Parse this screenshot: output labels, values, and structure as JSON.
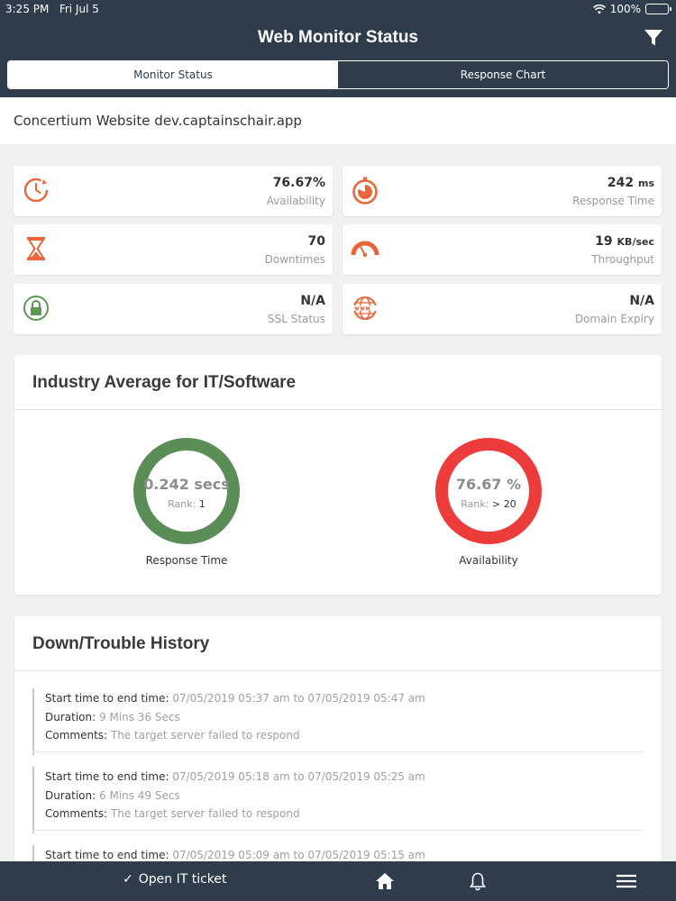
{
  "status_bar": {
    "time": "3:25 PM",
    "date": "Fri Jul 5",
    "battery": "100%"
  },
  "nav": {
    "title": "Web Monitor Status",
    "tabs": [
      {
        "label": "Monitor Status",
        "active": true
      },
      {
        "label": "Response Chart",
        "active": false
      }
    ]
  },
  "site": {
    "name": "Concertium Website dev.captainschair.app"
  },
  "metrics": [
    {
      "value": "76.67%",
      "unit": "",
      "label": "Availability",
      "icon": "availability-icon"
    },
    {
      "value": "242",
      "unit": "ms",
      "label": "Response Time",
      "icon": "stopwatch-icon"
    },
    {
      "value": "70",
      "unit": "",
      "label": "Downtimes",
      "icon": "hourglass-icon"
    },
    {
      "value": "19",
      "unit": "KB/sec",
      "label": "Throughput",
      "icon": "gauge-icon"
    },
    {
      "value": "N/A",
      "unit": "",
      "label": "SSL Status",
      "icon": "lock-icon"
    },
    {
      "value": "N/A",
      "unit": "",
      "label": "Domain Expiry",
      "icon": "globe-icon"
    }
  ],
  "industry": {
    "title": "Industry Average for IT/Software",
    "response": {
      "value": "0.242 secs",
      "rank_label": "Rank:",
      "rank": "1",
      "label": "Response Time",
      "color": "#5b8d57"
    },
    "availability": {
      "value": "76.67 %",
      "rank_label": "Rank:",
      "rank": "> 20",
      "label": "Availability",
      "color": "#ec3c3c"
    }
  },
  "history": {
    "title": "Down/Trouble History",
    "labels": {
      "time": "Start time to end time:",
      "duration": "Duration:",
      "comments": "Comments:"
    },
    "entries": [
      {
        "time": "07/05/2019 05:37 am to 07/05/2019 05:47 am",
        "duration": "9 Mins 36 Secs",
        "comments": "The target server failed to respond"
      },
      {
        "time": "07/05/2019 05:18 am to 07/05/2019 05:25 am",
        "duration": "6 Mins 49 Secs",
        "comments": "The target server failed to respond"
      },
      {
        "time": "07/05/2019 05:09 am to 07/05/2019 05:15 am"
      }
    ]
  },
  "tabbar": {
    "ticket_label": "Open IT ticket"
  },
  "colors": {
    "primary": "#2e3c4b",
    "accent": "#e8663a",
    "ssl": "#5b9a54",
    "ring_green": "#5b8d57",
    "ring_red": "#ec3c3c"
  }
}
